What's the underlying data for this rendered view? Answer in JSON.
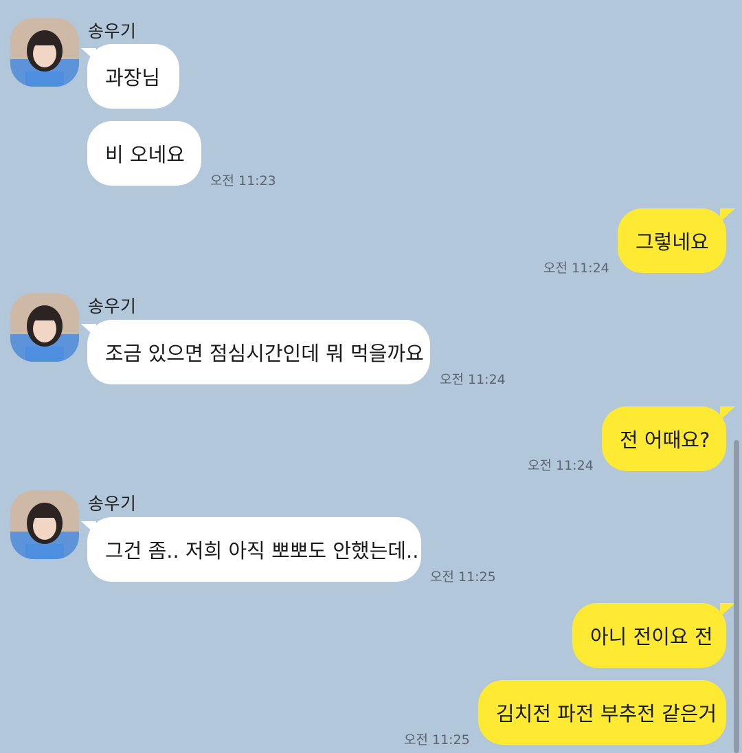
{
  "chat": {
    "background_color": "#b2c7da",
    "incoming_bubble_color": "#ffffff",
    "outgoing_bubble_color": "#fee933",
    "groups": [
      {
        "sender": "송우기",
        "direction": "incoming",
        "messages": [
          {
            "text": "과장님",
            "time": ""
          },
          {
            "text": "비 오네요",
            "time": "오전 11:23"
          }
        ]
      },
      {
        "direction": "outgoing",
        "messages": [
          {
            "text": "그렇네요",
            "time": "오전 11:24"
          }
        ]
      },
      {
        "sender": "송우기",
        "direction": "incoming",
        "messages": [
          {
            "text": "조금 있으면 점심시간인데 뭐 먹을까요",
            "time": "오전 11:24"
          }
        ]
      },
      {
        "direction": "outgoing",
        "messages": [
          {
            "text": "전 어때요?",
            "time": "오전 11:24"
          }
        ]
      },
      {
        "sender": "송우기",
        "direction": "incoming",
        "messages": [
          {
            "text": "그건 좀.. 저희 아직 뽀뽀도 안했는데..",
            "time": "오전 11:25"
          }
        ]
      },
      {
        "direction": "outgoing",
        "messages": [
          {
            "text": "아니 전이요 전",
            "time": ""
          },
          {
            "text": "김치전 파전 부추전 같은거",
            "time": "오전 11:25"
          }
        ]
      }
    ]
  }
}
